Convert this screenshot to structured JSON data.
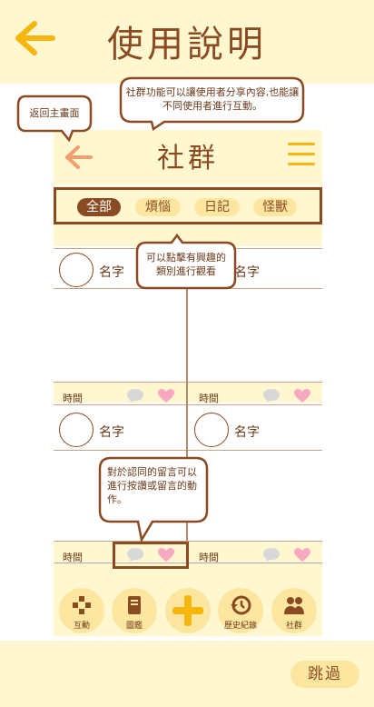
{
  "header": {
    "title": "使用說明",
    "back_icon": "arrow-left-icon"
  },
  "app": {
    "title": "社群",
    "filters": [
      {
        "label": "全部",
        "active": true
      },
      {
        "label": "煩惱",
        "active": false
      },
      {
        "label": "日記",
        "active": false
      },
      {
        "label": "怪獸",
        "active": false
      }
    ],
    "posts": [
      {
        "name": "名字",
        "time": "時間"
      },
      {
        "name": "名字",
        "time": "時間"
      },
      {
        "name": "名字",
        "time": "時間"
      },
      {
        "name": "名字",
        "time": "時間"
      }
    ],
    "nav": [
      {
        "label": "互動",
        "icon": "gamepad-icon"
      },
      {
        "label": "圖鑑",
        "icon": "book-icon"
      },
      {
        "label": "",
        "icon": "plus-icon"
      },
      {
        "label": "歷史紀錄",
        "icon": "history-icon"
      },
      {
        "label": "社群",
        "icon": "people-icon"
      }
    ]
  },
  "callouts": {
    "back_home": "返回主畫面",
    "community_intro": "社群功能可以讓使用者分享內容,也能讓不同使用者進行互動。",
    "filter_hint": "可以點擊有興趣的類別進行觀看",
    "reaction_hint": "對於認同的留言可以進行按讚或留言的動作。"
  },
  "skip_label": "跳過",
  "colors": {
    "brown": "#8a4a22",
    "cream": "#fff7cf",
    "yellow": "#fde7a0",
    "orange": "#f6b60e",
    "pink": "#f8a9c1",
    "gray": "#d8d8d8"
  }
}
